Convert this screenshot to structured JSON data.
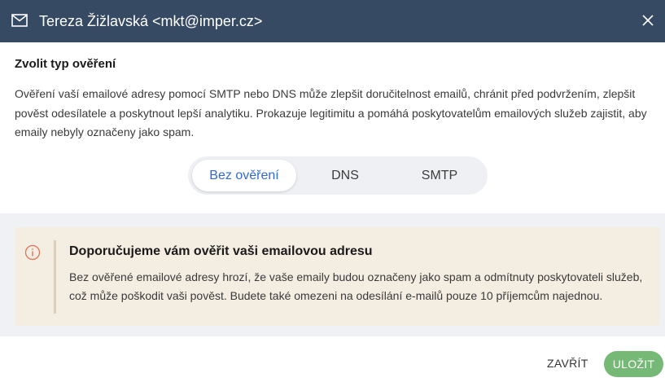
{
  "header": {
    "title": "Tereza Žižlavská <mkt@imper.cz>",
    "icon": "mail-icon",
    "close_icon": "close-icon"
  },
  "main": {
    "section_title": "Zvolit typ ověření",
    "description": "Ověření vaší emailové adresy pomocí SMTP nebo DNS může zlepšit doručitelnost emailů, chránit před podvržením, zlepšit pověst odesílatele a poskytnout lepší analytiku. Prokazuje legitimitu a pomáhá poskytovatelům emailových služeb zajistit, aby emaily nebyly označeny jako spam.",
    "verification_options": [
      "Bez ověření",
      "DNS",
      "SMTP"
    ],
    "selected_option": "Bez ověření"
  },
  "alert": {
    "icon": "info-icon",
    "title": "Doporučujeme vám ověřit vaši emailovou adresu",
    "body": "Bez ověřené emailové adresy hrozí, že vaše emaily budou označeny jako spam a odmítnuty poskytovateli služeb, což může poškodit vaši pověst. Budete také omezeni na odesílání e-mailů pouze 10 příjemcům najednou."
  },
  "footer": {
    "close_label": "ZAVŘÍT",
    "save_label": "ULOŽIT"
  },
  "colors": {
    "header_bg": "#364a64",
    "accent_blue": "#3069d6",
    "save_green": "#76b977",
    "alert_bg": "#f3ede2",
    "info_icon": "#e0745a"
  }
}
